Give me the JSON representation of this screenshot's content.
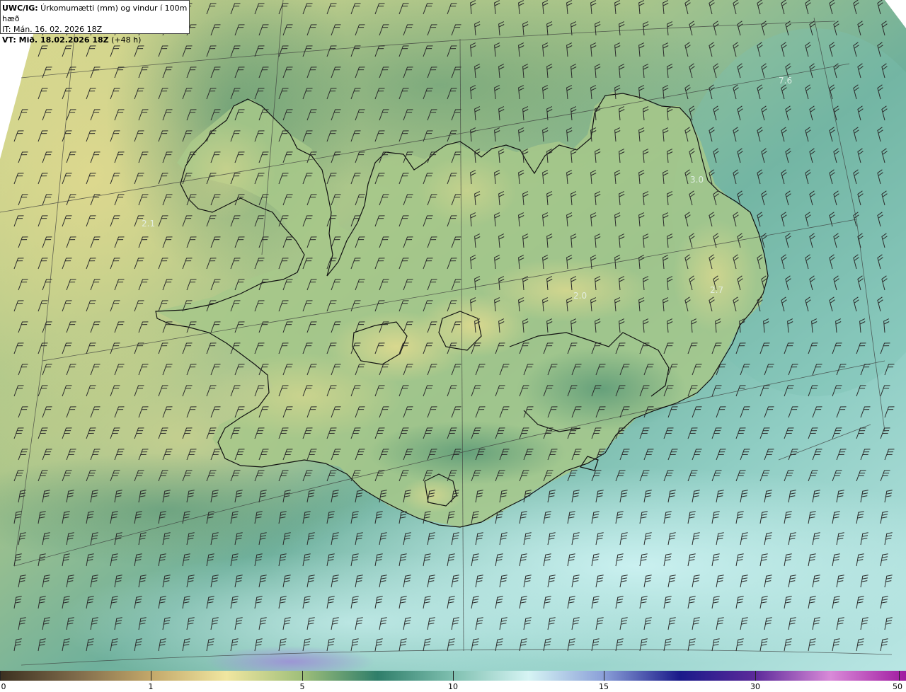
{
  "header": {
    "product": "UWC/IG:",
    "title": " Úrkomumætti (mm) og vindur í 100m hæð",
    "it_prefix": "IT:",
    "it_value": " Mán. 16. 02. 2026 18Z",
    "vt_prefix": "VT:",
    "vt_value": " Mið. 18.02.2026 18Z",
    "vt_offset": " (+48 h)"
  },
  "map": {
    "labels": [
      "7.6",
      "3.0",
      "2.1",
      "2.7",
      "2.0"
    ],
    "colors": {
      "sea_dark": "#2f7f6c",
      "sea_mid": "#6fb4a6",
      "sea_light": "#a6dad6",
      "land_low": "#9bbf86",
      "land_high": "#d5d487",
      "coast": "#111111",
      "barb": "#2a2a2a",
      "pale_blue": "#bfe9ee",
      "violet": "#b7a8dc"
    }
  },
  "colorbar": {
    "ticks": [
      "0",
      "1",
      "5",
      "10",
      "15",
      "30",
      "50"
    ],
    "tick_values": [
      0,
      1,
      5,
      10,
      15,
      30,
      50
    ],
    "stops": [
      "#3b3020",
      "#7e6a4a",
      "#c3a86a",
      "#f0e6a0",
      "#9fbf7a",
      "#2f7e6a",
      "#7fc0b0",
      "#d6f4f4",
      "#8a9fd8",
      "#1a1a8a",
      "#5c2a9a",
      "#d98ad8",
      "#a01aa0"
    ]
  }
}
